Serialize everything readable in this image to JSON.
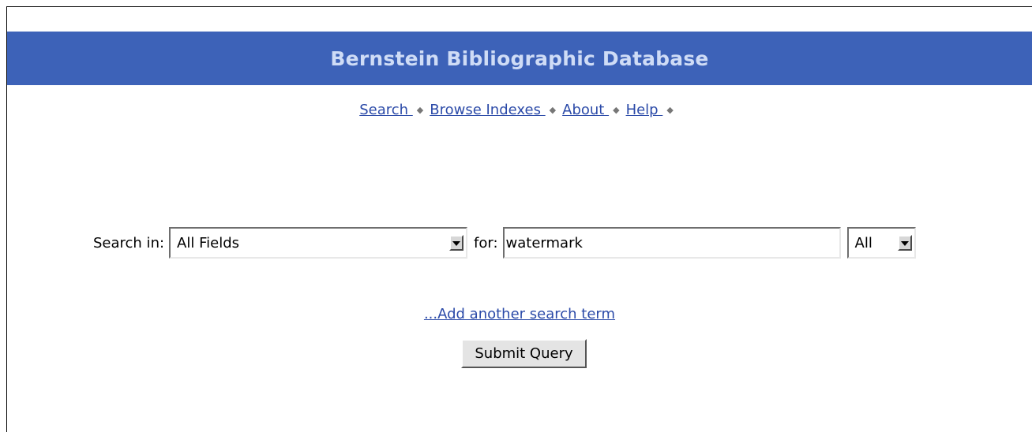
{
  "header": {
    "title": "Bernstein Bibliographic Database",
    "background_color": "#3d62b8",
    "title_color": "#cfdcf6"
  },
  "nav": {
    "separator_glyph": "◆",
    "items": [
      {
        "label": "Search "
      },
      {
        "label": "Browse Indexes "
      },
      {
        "label": "About "
      },
      {
        "label": "Help "
      }
    ],
    "link_color": "#2b4aa8"
  },
  "search": {
    "search_in_label": "Search in:",
    "field_select_value": "All Fields",
    "for_label": "for:",
    "term_value": "watermark",
    "match_select_value": "All"
  },
  "add_term_link": "...Add another search term",
  "submit_label": "Submit Query"
}
